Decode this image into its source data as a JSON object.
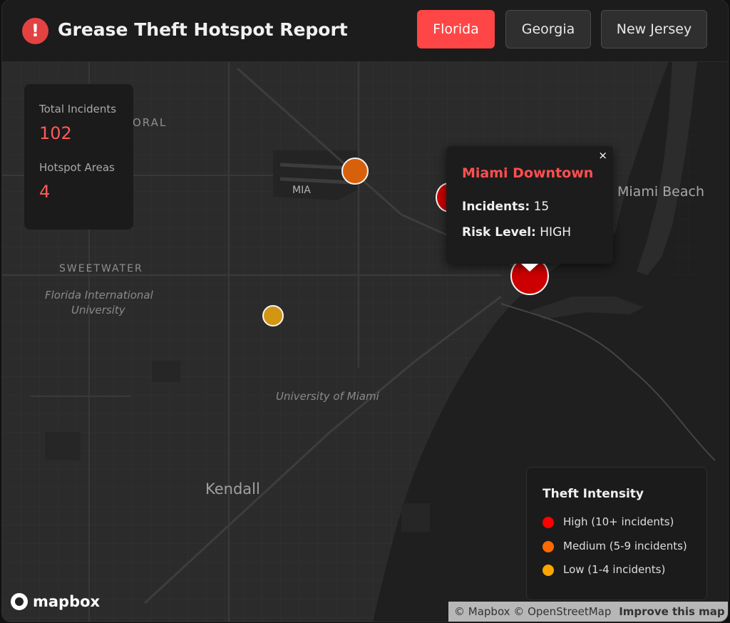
{
  "header": {
    "icon": "alert-circle-icon",
    "title": "Grease Theft Hotspot Report",
    "states": [
      {
        "label": "Florida",
        "active": true
      },
      {
        "label": "Georgia",
        "active": false
      },
      {
        "label": "New Jersey",
        "active": false
      }
    ]
  },
  "stats": {
    "total_label": "Total Incidents",
    "total_value": "102",
    "hotspot_label": "Hotspot Areas",
    "hotspot_value": "4"
  },
  "map_labels": {
    "doral": "ORAL",
    "mia": "MIA",
    "miami_beach": "Miami Beach",
    "sweetwater": "SWEETWATER",
    "fiu_line1": "Florida International",
    "fiu_line2": "University",
    "um": "University of Miami",
    "kendall": "Kendall"
  },
  "popup": {
    "title": "Miami Downtown",
    "incidents_label": "Incidents:",
    "incidents_value": "15",
    "risk_label": "Risk Level:",
    "risk_value": "HIGH",
    "close": "×"
  },
  "legend": {
    "title": "Theft Intensity",
    "items": [
      {
        "label": "High (10+ incidents)",
        "color": "#ff0000"
      },
      {
        "label": "Medium (5-9 incidents)",
        "color": "#ff6a00"
      },
      {
        "label": "Low (1-4 incidents)",
        "color": "#ffa500"
      }
    ]
  },
  "markers": {
    "high": "#cc0000",
    "medium": "#d9600b",
    "low": "#d39613"
  },
  "footer": {
    "logo": "mapbox",
    "attribution_mapbox": "© Mapbox",
    "attribution_osm": "© OpenStreetMap",
    "improve": "Improve this map"
  }
}
